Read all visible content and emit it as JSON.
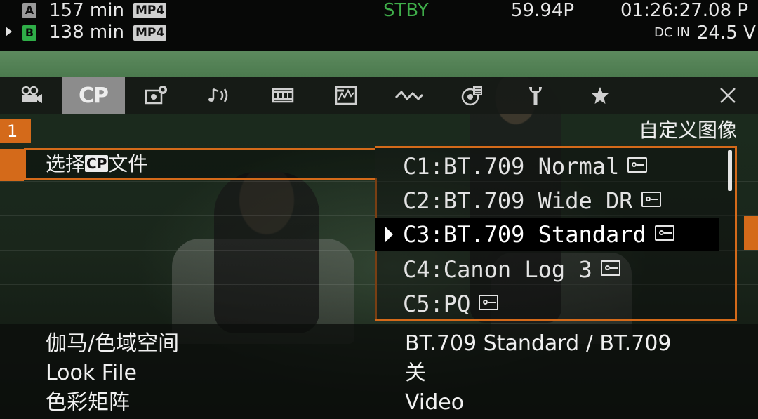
{
  "status": {
    "slot_a_label": "A",
    "slot_a_time": "157 min",
    "slot_a_format": "MP4",
    "slot_b_label": "B",
    "slot_b_time": "138 min",
    "slot_b_format": "MP4",
    "state": "STBY",
    "frame_rate": "59.94P",
    "timecode": "01:26:27.08 P",
    "power_label": "DC IN",
    "voltage": "24.5 V"
  },
  "tabs": [
    {
      "icon": "camera-icon"
    },
    {
      "icon": "cp-icon",
      "label": "CP",
      "active": true
    },
    {
      "icon": "camera-settings-icon"
    },
    {
      "icon": "audio-icon"
    },
    {
      "icon": "video-setup-icon"
    },
    {
      "icon": "waveform-monitor-icon"
    },
    {
      "icon": "wireless-icon"
    },
    {
      "icon": "recording-media-icon"
    },
    {
      "icon": "wrench-icon"
    },
    {
      "icon": "star-icon"
    },
    {
      "icon": "close-icon"
    }
  ],
  "menu": {
    "page_number": "1",
    "title": "自定义图像",
    "item_prefix": "选择",
    "item_badge": "CP",
    "item_suffix": "文件"
  },
  "options": [
    {
      "label": "C1:BT.709 Normal",
      "locked": true,
      "selected": false
    },
    {
      "label": "C2:BT.709 Wide DR",
      "locked": true,
      "selected": false
    },
    {
      "label": "C3:BT.709 Standard",
      "locked": true,
      "selected": true
    },
    {
      "label": "C4:Canon Log 3",
      "locked": true,
      "selected": false
    },
    {
      "label": "C5:PQ",
      "locked": true,
      "selected": false
    }
  ],
  "settings": [
    {
      "label": "伽马/色域空间",
      "value": "BT.709 Standard / BT.709"
    },
    {
      "label": "Look File",
      "value": "关"
    },
    {
      "label": "色彩矩阵",
      "value": "Video"
    }
  ],
  "colors": {
    "accent": "#d46a1a",
    "standby": "#3fae4a",
    "slot_b": "#2fae48"
  }
}
